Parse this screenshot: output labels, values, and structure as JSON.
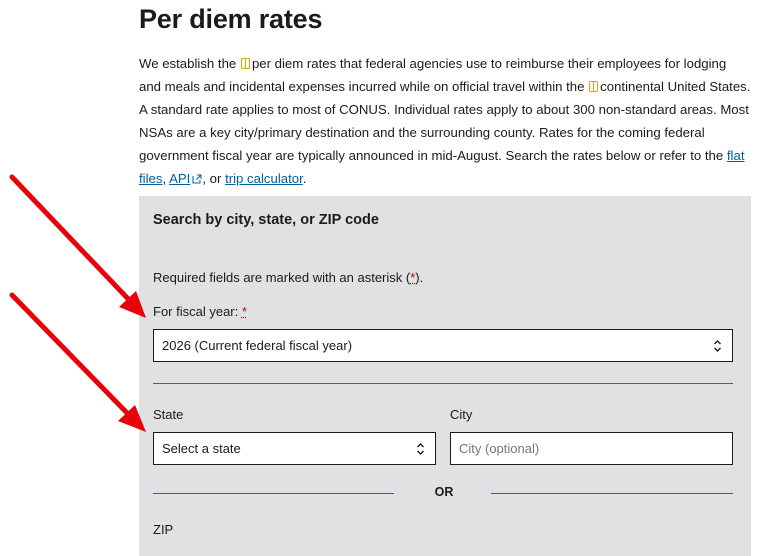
{
  "page": {
    "title": "Per diem rates",
    "intro": {
      "p1": "We establish the",
      "p2": "per diem rates that federal agencies use to reimburse their employees for lodging and meals and incidental expenses incurred while on official travel within the",
      "p3": "continental United States. A standard rate applies to most of CONUS. Individual rates apply to about 300 non-standard areas. Most NSAs are a key city/primary destination and the surrounding county. Rates for the coming federal government fiscal year are typically announced in mid-August. Search the rates below or refer to the",
      "link_flat_files": "flat files",
      "sep1": ",",
      "link_api": "API",
      "sep2": ", or",
      "link_trip_calculator": "trip calculator",
      "end": "."
    }
  },
  "search": {
    "heading": "Search by city, state, or ZIP code",
    "required_note_prefix": "Required fields are marked with an asterisk (",
    "asterisk": "*",
    "required_note_suffix": ").",
    "fiscal_year_label": "For fiscal year:",
    "fiscal_year_value": "2026 (Current federal fiscal year)",
    "state_label": "State",
    "state_value": "Select a state",
    "city_label": "City",
    "city_placeholder": "City (optional)",
    "or_text": "OR",
    "zip_label": "ZIP"
  },
  "colors": {
    "link": "#005ea2",
    "panel_bg": "#dfe1e2",
    "asterisk": "#b50909",
    "annotation_arrow": "#e8000b"
  },
  "icons": {
    "glossary": "book-icon",
    "external": "external-link-icon",
    "select": "chevron-updown-icon"
  }
}
